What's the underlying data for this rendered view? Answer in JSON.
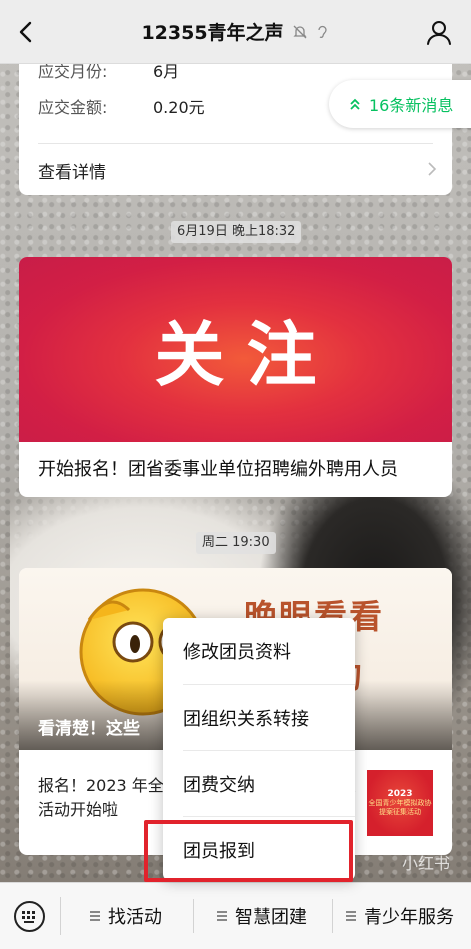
{
  "header": {
    "title": "12355青年之声"
  },
  "top_card": {
    "row1_label": "应交月份:",
    "row1_value": "6月",
    "row2_label": "应交金额:",
    "row2_value": "0.20元",
    "details_label": "查看详情"
  },
  "new_messages": "16条新消息",
  "timestamps": [
    "6月19日 晚上18:32",
    "周二 19:30"
  ],
  "article1": {
    "banner_text": "关注",
    "title": "开始报名！团省委事业单位招聘编外聘用人员"
  },
  "article2": {
    "cover_line1": "晚眼看看",
    "cover_line2": "的",
    "cover_caption": "看清楚！这些",
    "sub_title": "报名！2023 年全国青少年模拟政协提案征集活动开始啦",
    "thumb_year": "2023",
    "thumb_text": "全国青少年模拟政协提案征集活动"
  },
  "watermark": "小红书",
  "menu": {
    "items": [
      "修改团员资料",
      "团组织关系转接",
      "团费交纳",
      "团员报到"
    ],
    "highlighted_index": 3
  },
  "bottom_bar": {
    "tabs": [
      "找活动",
      "智慧团建",
      "青少年服务"
    ]
  },
  "colors": {
    "accent_green": "#07c160",
    "highlight_red": "#e1232c",
    "banner_red": "#d21f45"
  }
}
